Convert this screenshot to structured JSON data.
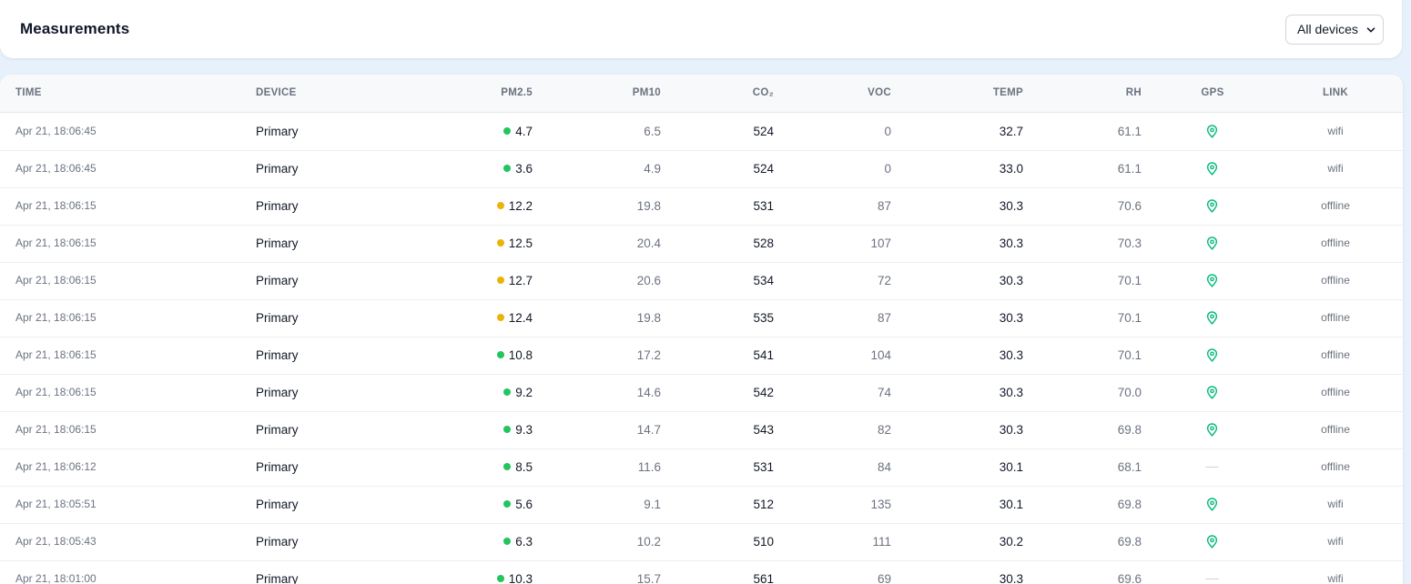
{
  "header": {
    "title": "Measurements",
    "device_filter": "All devices"
  },
  "table": {
    "columns": {
      "time": "TIME",
      "device": "DEVICE",
      "pm25": "PM2.5",
      "pm10": "PM10",
      "co2": "CO₂",
      "voc": "VOC",
      "temp": "TEMP",
      "rh": "RH",
      "gps": "GPS",
      "link": "LINK"
    },
    "status_colors": {
      "good": "#22c55e",
      "moderate": "#eab308"
    },
    "gps_icon": "map-pin-icon",
    "gps_icon_color": "#10b981",
    "rows": [
      {
        "time": "Apr 21, 18:06:45",
        "device": "Primary",
        "pm25": "4.7",
        "pm25_status": "good",
        "pm10": "6.5",
        "co2": "524",
        "voc": "0",
        "temp": "32.7",
        "rh": "61.1",
        "gps": true,
        "link": "wifi"
      },
      {
        "time": "Apr 21, 18:06:45",
        "device": "Primary",
        "pm25": "3.6",
        "pm25_status": "good",
        "pm10": "4.9",
        "co2": "524",
        "voc": "0",
        "temp": "33.0",
        "rh": "61.1",
        "gps": true,
        "link": "wifi"
      },
      {
        "time": "Apr 21, 18:06:15",
        "device": "Primary",
        "pm25": "12.2",
        "pm25_status": "moderate",
        "pm10": "19.8",
        "co2": "531",
        "voc": "87",
        "temp": "30.3",
        "rh": "70.6",
        "gps": true,
        "link": "offline"
      },
      {
        "time": "Apr 21, 18:06:15",
        "device": "Primary",
        "pm25": "12.5",
        "pm25_status": "moderate",
        "pm10": "20.4",
        "co2": "528",
        "voc": "107",
        "temp": "30.3",
        "rh": "70.3",
        "gps": true,
        "link": "offline"
      },
      {
        "time": "Apr 21, 18:06:15",
        "device": "Primary",
        "pm25": "12.7",
        "pm25_status": "moderate",
        "pm10": "20.6",
        "co2": "534",
        "voc": "72",
        "temp": "30.3",
        "rh": "70.1",
        "gps": true,
        "link": "offline"
      },
      {
        "time": "Apr 21, 18:06:15",
        "device": "Primary",
        "pm25": "12.4",
        "pm25_status": "moderate",
        "pm10": "19.8",
        "co2": "535",
        "voc": "87",
        "temp": "30.3",
        "rh": "70.1",
        "gps": true,
        "link": "offline"
      },
      {
        "time": "Apr 21, 18:06:15",
        "device": "Primary",
        "pm25": "10.8",
        "pm25_status": "good",
        "pm10": "17.2",
        "co2": "541",
        "voc": "104",
        "temp": "30.3",
        "rh": "70.1",
        "gps": true,
        "link": "offline"
      },
      {
        "time": "Apr 21, 18:06:15",
        "device": "Primary",
        "pm25": "9.2",
        "pm25_status": "good",
        "pm10": "14.6",
        "co2": "542",
        "voc": "74",
        "temp": "30.3",
        "rh": "70.0",
        "gps": true,
        "link": "offline"
      },
      {
        "time": "Apr 21, 18:06:15",
        "device": "Primary",
        "pm25": "9.3",
        "pm25_status": "good",
        "pm10": "14.7",
        "co2": "543",
        "voc": "82",
        "temp": "30.3",
        "rh": "69.8",
        "gps": true,
        "link": "offline"
      },
      {
        "time": "Apr 21, 18:06:12",
        "device": "Primary",
        "pm25": "8.5",
        "pm25_status": "good",
        "pm10": "11.6",
        "co2": "531",
        "voc": "84",
        "temp": "30.1",
        "rh": "68.1",
        "gps": false,
        "link": "offline"
      },
      {
        "time": "Apr 21, 18:05:51",
        "device": "Primary",
        "pm25": "5.6",
        "pm25_status": "good",
        "pm10": "9.1",
        "co2": "512",
        "voc": "135",
        "temp": "30.1",
        "rh": "69.8",
        "gps": true,
        "link": "wifi"
      },
      {
        "time": "Apr 21, 18:05:43",
        "device": "Primary",
        "pm25": "6.3",
        "pm25_status": "good",
        "pm10": "10.2",
        "co2": "510",
        "voc": "111",
        "temp": "30.2",
        "rh": "69.8",
        "gps": true,
        "link": "wifi"
      },
      {
        "time": "Apr 21, 18:01:00",
        "device": "Primary",
        "pm25": "10.3",
        "pm25_status": "good",
        "pm10": "15.7",
        "co2": "561",
        "voc": "69",
        "temp": "30.3",
        "rh": "69.6",
        "gps": false,
        "link": "wifi"
      }
    ]
  }
}
